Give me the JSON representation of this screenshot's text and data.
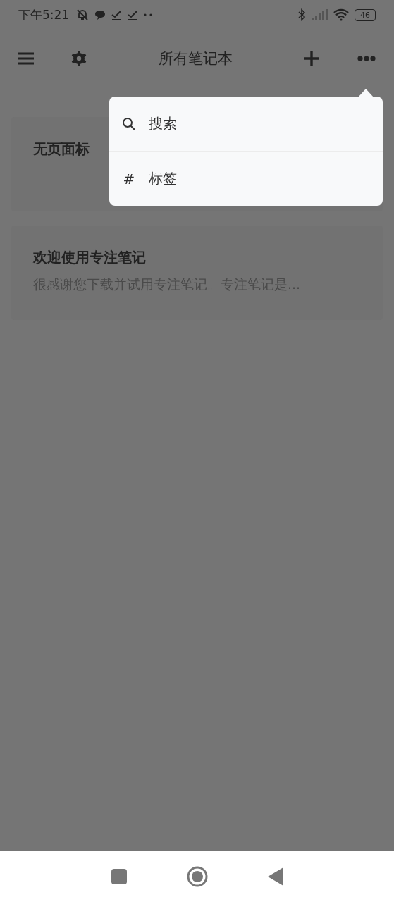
{
  "status_bar": {
    "time": "下午5:21",
    "battery": "46"
  },
  "top_bar": {
    "title": "所有笔记本"
  },
  "notes": [
    {
      "title": "无页面标"
    },
    {
      "title": "欢迎使用专注笔记",
      "preview": "很感谢您下载并试用专注笔记。专注笔记是..."
    }
  ],
  "menu": {
    "items": [
      {
        "kind": "search",
        "label": "搜索"
      },
      {
        "kind": "tag",
        "glyph": "#",
        "label": "标签"
      }
    ]
  }
}
